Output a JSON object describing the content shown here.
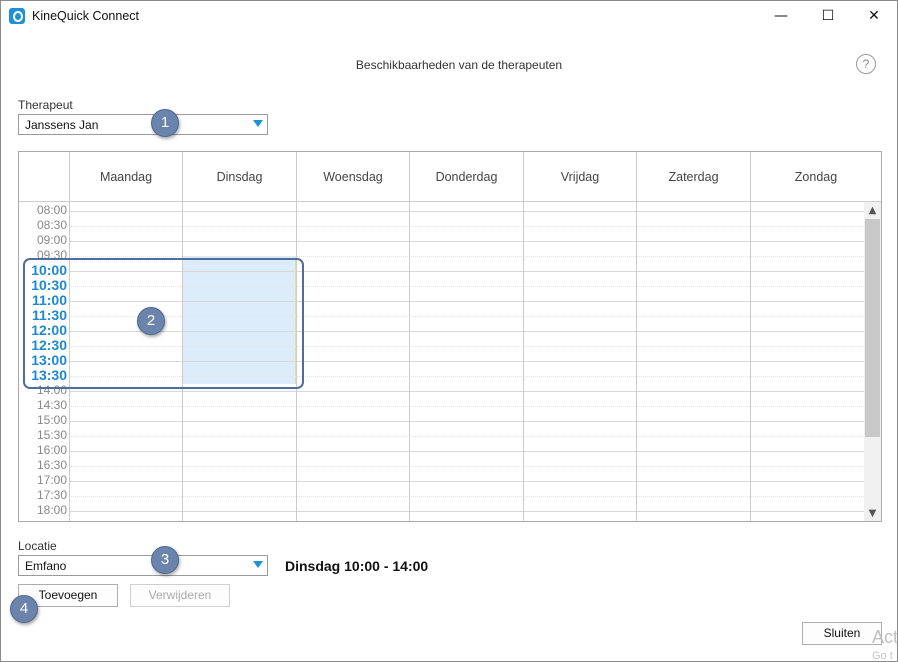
{
  "window": {
    "title": "KineQuick Connect",
    "minimize": "—",
    "maximize": "☐",
    "close": "✕"
  },
  "page": {
    "title": "Beschikbaarheden van de therapeuten",
    "help": "?"
  },
  "therapeut": {
    "label": "Therapeut",
    "value": "Janssens Jan"
  },
  "calendar": {
    "days": [
      "Maandag",
      "Dinsdag",
      "Woensdag",
      "Donderdag",
      "Vrijdag",
      "Zaterdag",
      "Zondag"
    ],
    "times": [
      "08:00",
      "08:30",
      "09:00",
      "09:30",
      "10:00",
      "10:30",
      "11:00",
      "11:30",
      "12:00",
      "12:30",
      "13:00",
      "13:30",
      "14:00",
      "14:30",
      "15:00",
      "15:30",
      "16:00",
      "16:30",
      "17:00",
      "17:30",
      "18:00"
    ],
    "highlighted_times": [
      "10:00",
      "10:30",
      "11:00",
      "11:30",
      "12:00",
      "12:30",
      "13:00",
      "13:30"
    ],
    "selected_day": "Dinsdag"
  },
  "locatie": {
    "label": "Locatie",
    "value": "Emfano"
  },
  "summary": "Dinsdag 10:00 - 14:00",
  "buttons": {
    "add": "Toevoegen",
    "remove": "Verwijderen",
    "close": "Sluiten"
  },
  "badges": [
    "1",
    "2",
    "3",
    "4"
  ],
  "watermark": {
    "line1": "Act",
    "line2": "Go t"
  },
  "colors": {
    "accent": "#1e90d6",
    "selection": "#dcecfb",
    "badge": "#6b84ac",
    "highlight_time": "#1e88d2"
  }
}
